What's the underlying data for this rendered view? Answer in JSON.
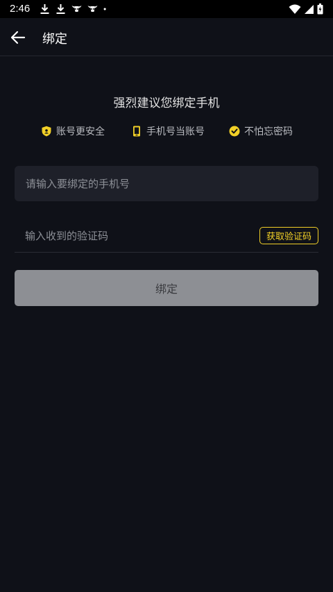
{
  "status_bar": {
    "time": "2:46",
    "icons_left": [
      "download-icon",
      "download-icon",
      "bull-icon",
      "bull-icon",
      "dot-icon"
    ],
    "icons_right": [
      "wifi-icon",
      "signal-icon",
      "battery-icon"
    ]
  },
  "app_bar": {
    "back_icon": "arrow-left-icon",
    "title": "绑定"
  },
  "headline": "强烈建议您绑定手机",
  "benefits": [
    {
      "icon": "shield-icon",
      "label": "账号更安全"
    },
    {
      "icon": "phone-icon",
      "label": "手机号当账号"
    },
    {
      "icon": "check-badge-icon",
      "label": "不怕忘密码"
    }
  ],
  "phone_input": {
    "placeholder": "请输入要绑定的手机号",
    "value": ""
  },
  "code_input": {
    "placeholder": "输入收到的验证码",
    "value": ""
  },
  "get_code_button": "获取验证码",
  "bind_button": "绑定",
  "colors": {
    "background": "#0f1118",
    "accent": "#f2d027",
    "field_bg": "#1e2029",
    "disabled_button": "#8d8f94"
  }
}
